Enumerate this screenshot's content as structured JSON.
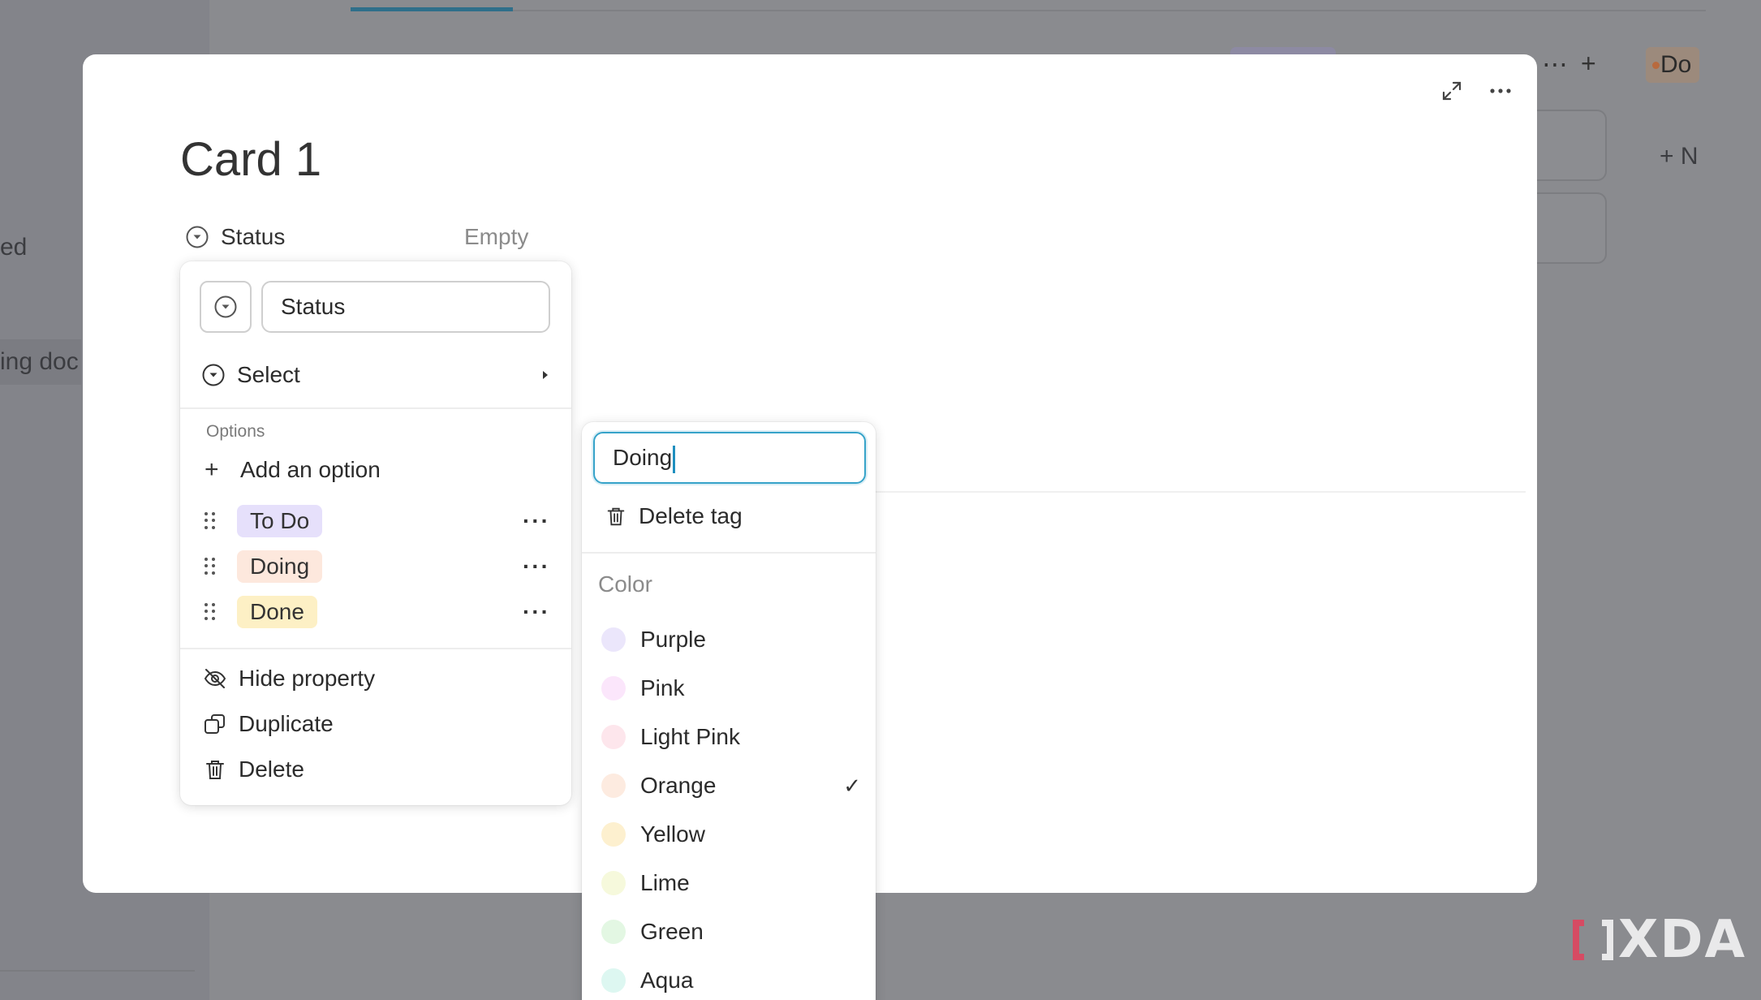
{
  "background": {
    "sidebar_items": [
      "ed",
      "ing doc"
    ],
    "header_more_icon": "more-horizontal-icon",
    "header_add_icon": "plus-icon",
    "column_badge": "Do",
    "add_new_label": "N"
  },
  "modal": {
    "title": "Card 1",
    "expand_icon": "expand-icon",
    "more_icon": "more-horizontal-icon",
    "property": {
      "icon": "select-circle-icon",
      "label": "Status",
      "value": "Empty"
    }
  },
  "property_menu": {
    "name_value": "Status",
    "type_label": "Select",
    "options_heading": "Options",
    "add_option_label": "Add an option",
    "options": [
      {
        "label": "To Do",
        "color": "#e6e0fb"
      },
      {
        "label": "Doing",
        "color": "#fde8dd"
      },
      {
        "label": "Done",
        "color": "#fdf0c5"
      }
    ],
    "actions": {
      "hide": "Hide property",
      "duplicate": "Duplicate",
      "delete": "Delete"
    }
  },
  "tag_menu": {
    "tag_name": "Doing",
    "delete_label": "Delete tag",
    "color_heading": "Color",
    "selected_color": "Orange",
    "colors": [
      {
        "name": "Purple",
        "hex": "#ebe6fb"
      },
      {
        "name": "Pink",
        "hex": "#fbe6fb"
      },
      {
        "name": "Light Pink",
        "hex": "#fde6ec"
      },
      {
        "name": "Orange",
        "hex": "#fdebe0"
      },
      {
        "name": "Yellow",
        "hex": "#fdf0cf"
      },
      {
        "name": "Lime",
        "hex": "#f6f9dc"
      },
      {
        "name": "Green",
        "hex": "#e3f7e3"
      },
      {
        "name": "Aqua",
        "hex": "#ddf7f1"
      }
    ]
  },
  "watermark": {
    "text": "XDA"
  }
}
